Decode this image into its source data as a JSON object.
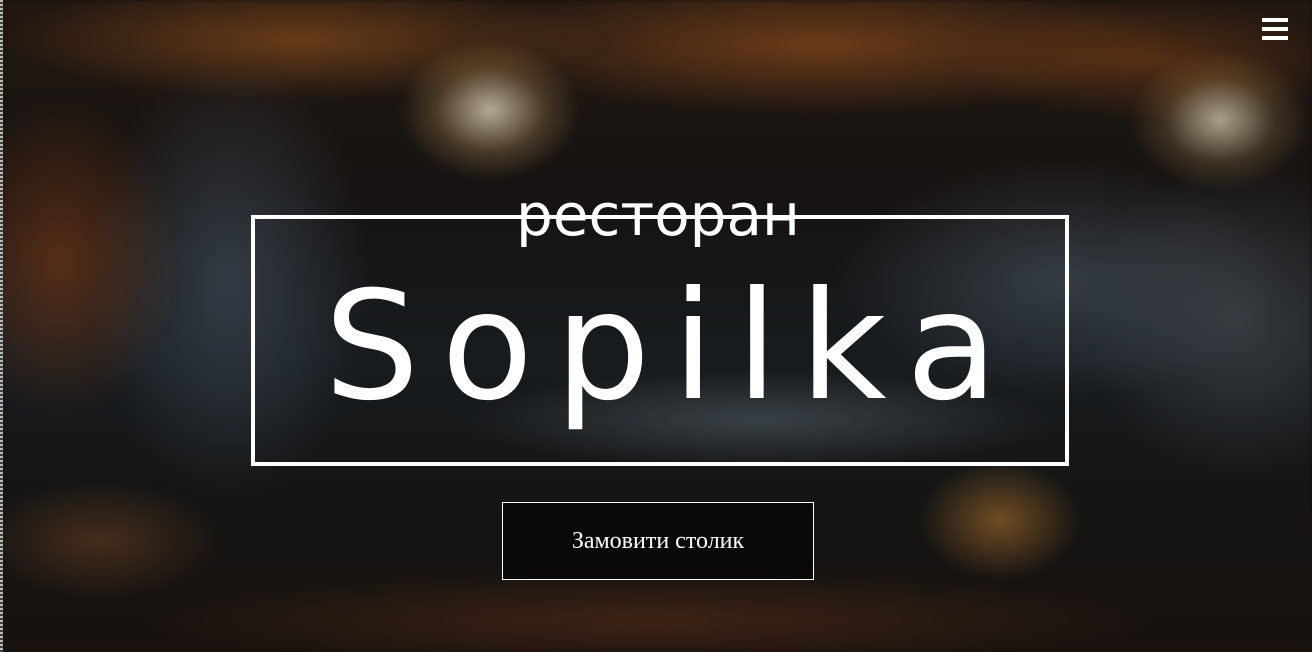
{
  "header": {
    "menu_icon": "hamburger-menu-icon"
  },
  "hero": {
    "subtitle": "ресторан",
    "title": "Sopilka",
    "reserve_label": "Замовити столик"
  },
  "colors": {
    "text": "#ffffff",
    "frame": "#ffffff",
    "button_border": "#ffffff"
  }
}
